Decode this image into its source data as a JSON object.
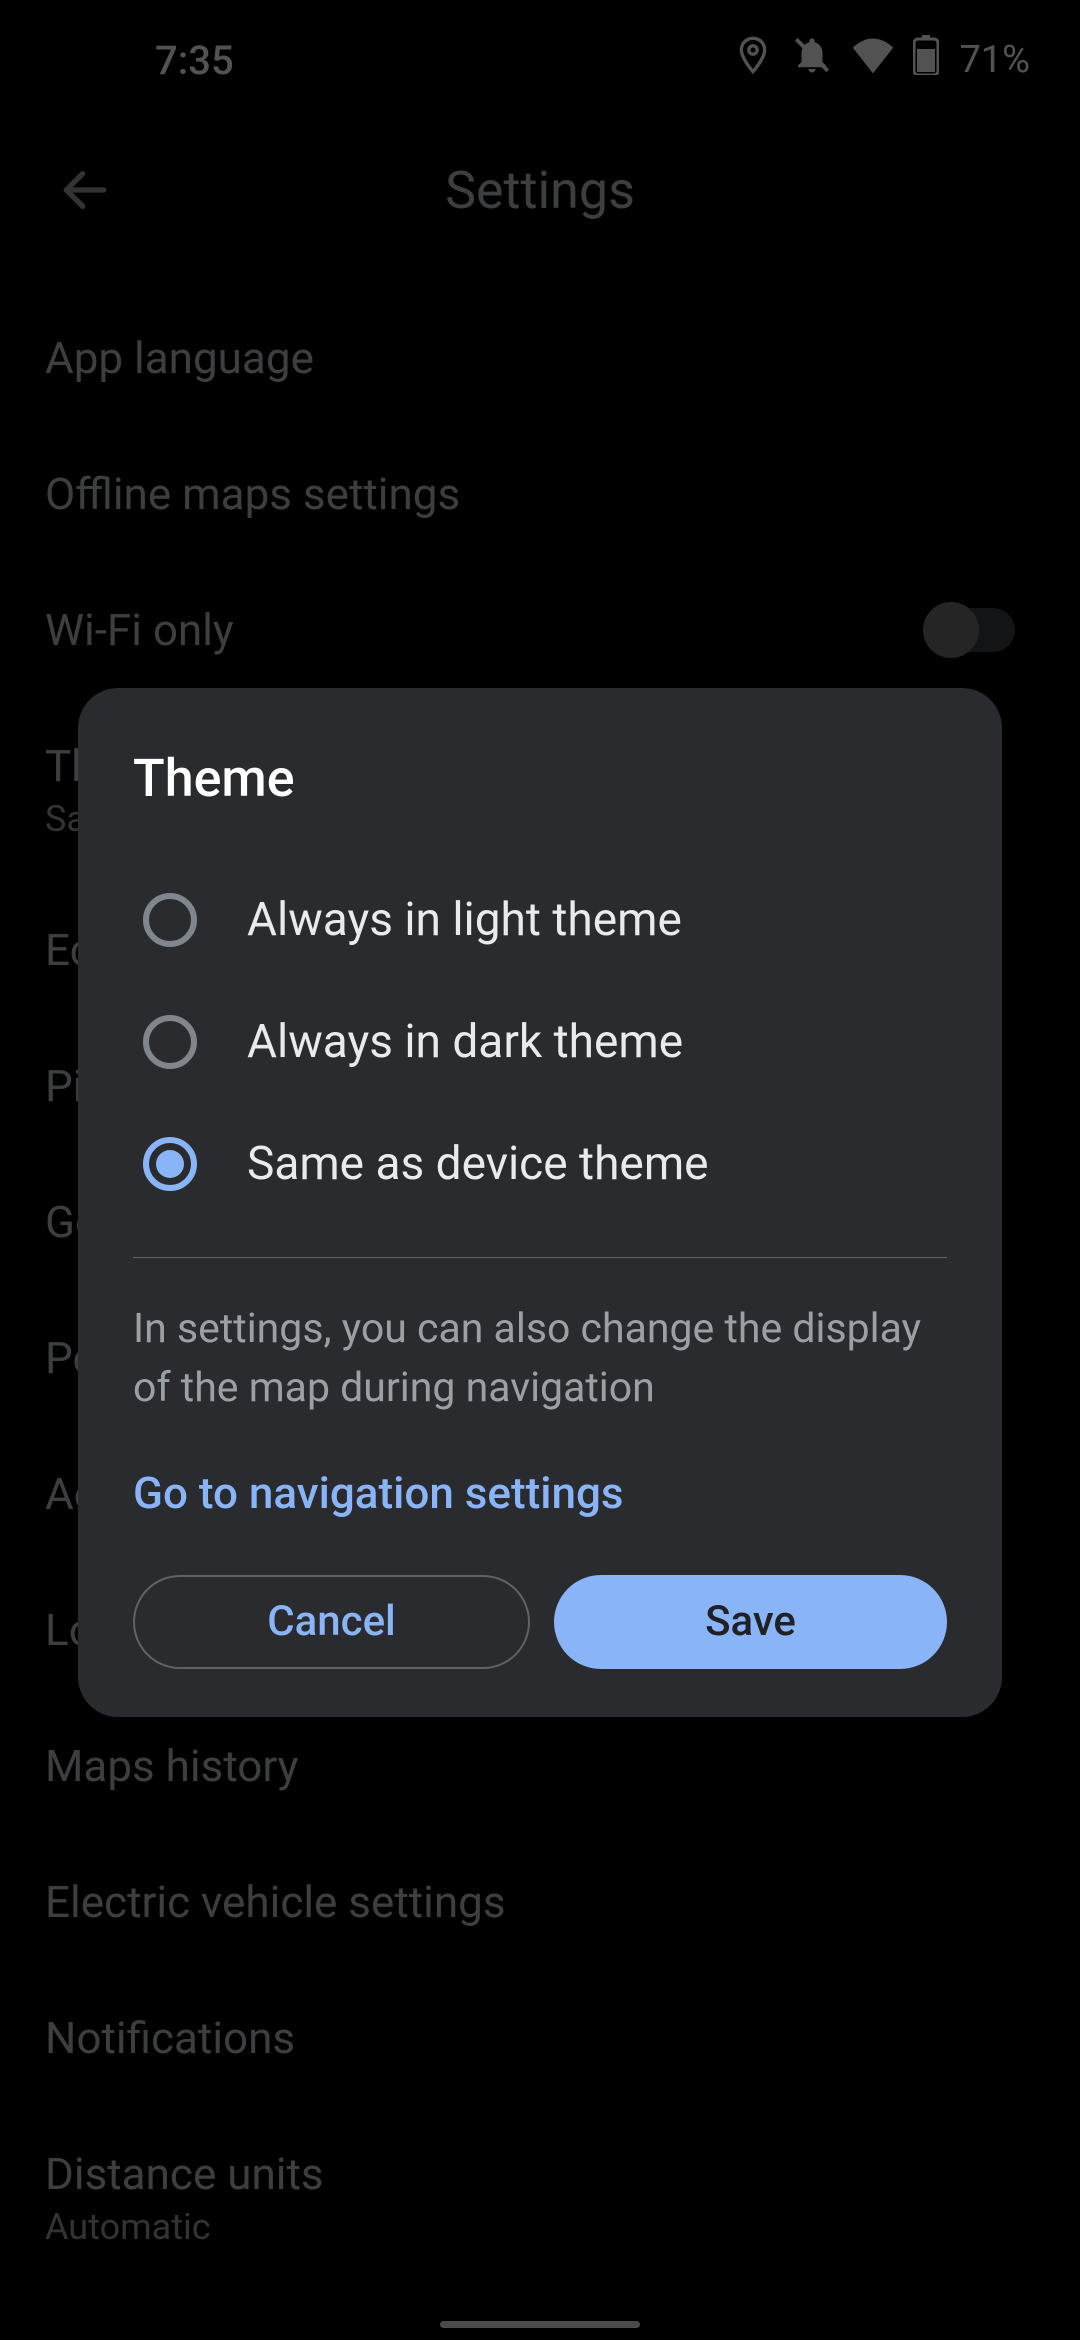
{
  "status": {
    "time": "7:35",
    "battery_pct": "71%"
  },
  "header": {
    "title": "Settings"
  },
  "settings": {
    "app_language": "App language",
    "offline_maps": "Offline maps settings",
    "wifi_only": "Wi-Fi only",
    "theme_title": "Th",
    "theme_sub": "Sa",
    "ec": "Ec",
    "pi": "Pi",
    "go": "Go",
    "pe": "Pe",
    "ac": "Ac",
    "lo": "Lo",
    "maps_history": "Maps history",
    "ev_settings": "Electric vehicle settings",
    "notifications": "Notifications",
    "distance_title": "Distance units",
    "distance_sub": "Automatic"
  },
  "dialog": {
    "title": "Theme",
    "options": {
      "light": "Always in light theme",
      "dark": "Always in dark theme",
      "device": "Same as device theme"
    },
    "desc": "In settings, you can also change the display of the map during navigation",
    "link": "Go to navigation settings",
    "cancel": "Cancel",
    "save": "Save",
    "selected_index": 2
  }
}
